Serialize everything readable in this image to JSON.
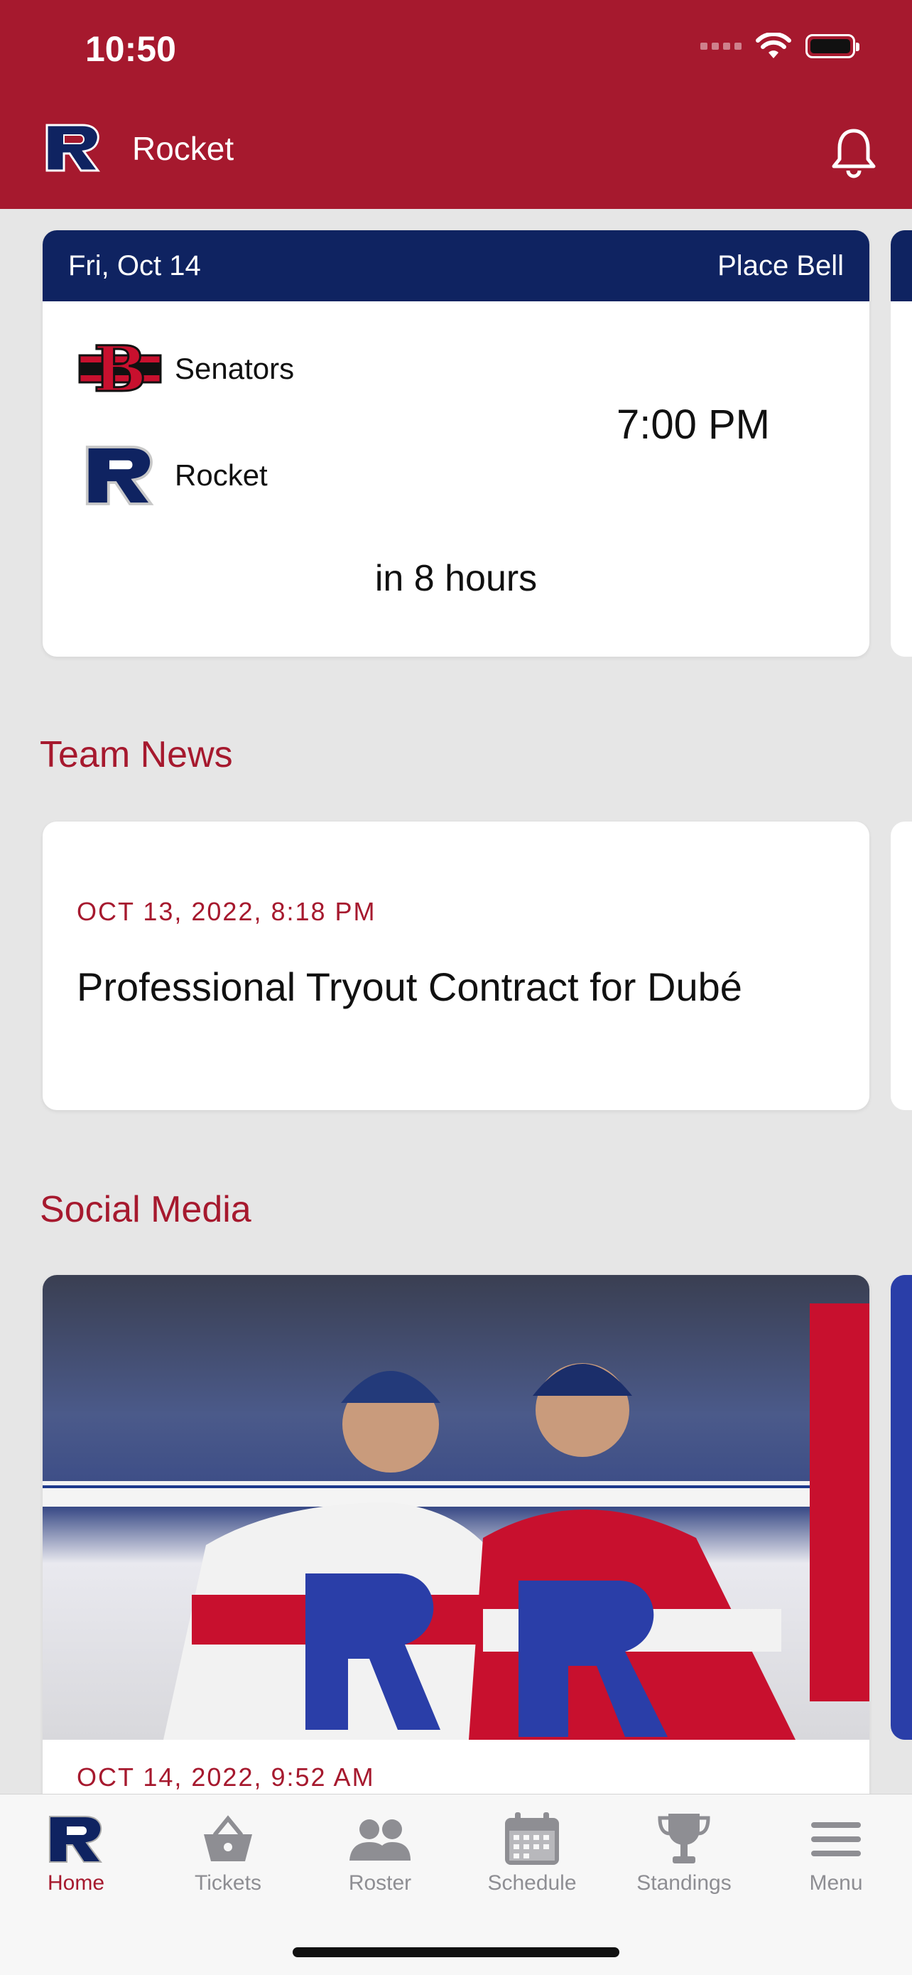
{
  "status_bar": {
    "time": "10:50"
  },
  "header": {
    "title": "Rocket"
  },
  "game": {
    "date": "Fri, Oct 14",
    "venue": "Place Bell",
    "away_team": "Senators",
    "home_team": "Rocket",
    "time": "7:00 PM",
    "countdown": "in 8 hours"
  },
  "team_news": {
    "section_title": "Team News",
    "date": "OCT 13, 2022, 8:18 PM",
    "title": "Professional Tryout Contract for Dubé"
  },
  "social_media": {
    "section_title": "Social Media",
    "date": "OCT 14, 2022, 9:52 AM"
  },
  "tabs": [
    {
      "label": "Home",
      "icon": "rocket-logo-icon",
      "active": true
    },
    {
      "label": "Tickets",
      "icon": "basket-icon"
    },
    {
      "label": "Roster",
      "icon": "people-icon"
    },
    {
      "label": "Schedule",
      "icon": "calendar-icon"
    },
    {
      "label": "Standings",
      "icon": "trophy-icon"
    },
    {
      "label": "Menu",
      "icon": "menu-icon"
    }
  ],
  "colors": {
    "primary": "#a6192e",
    "navy": "#0f2361",
    "background": "#e6e6e6"
  }
}
